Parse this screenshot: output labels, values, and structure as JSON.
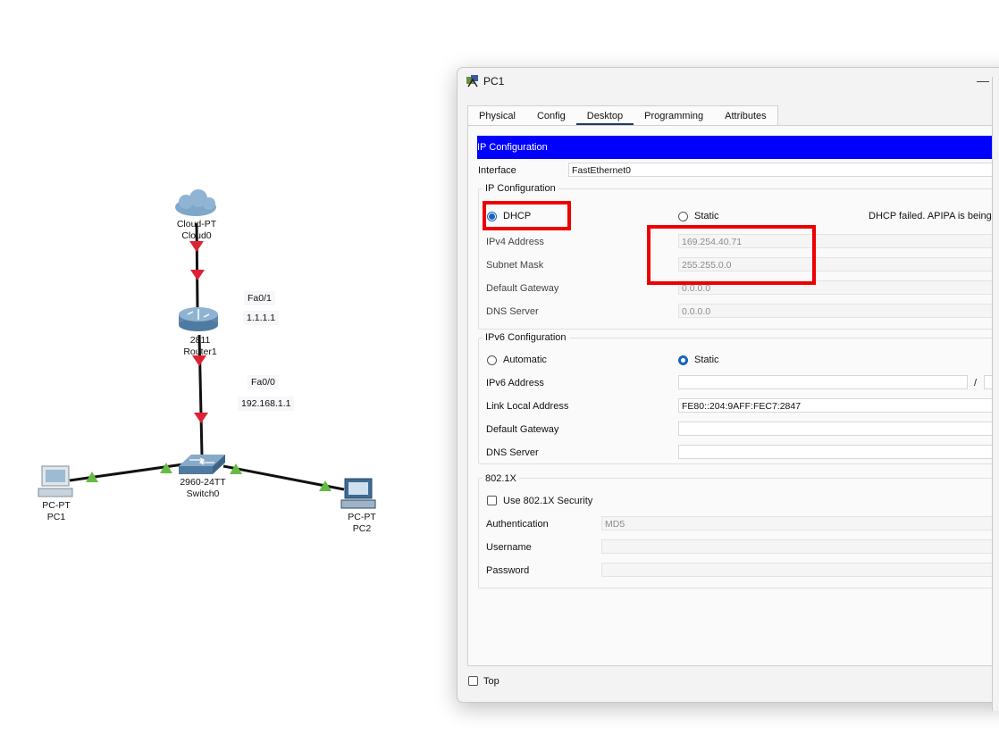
{
  "topology": {
    "devices": [
      {
        "id": "cloud",
        "type_label": "Cloud-PT",
        "name": "Cloud0"
      },
      {
        "id": "router",
        "type_label": "2811",
        "name": "Router1"
      },
      {
        "id": "switch",
        "type_label": "2960-24TT",
        "name": "Switch0"
      },
      {
        "id": "pc1",
        "type_label": "PC-PT",
        "name": "PC1"
      },
      {
        "id": "pc2",
        "type_label": "PC-PT",
        "name": "PC2"
      }
    ],
    "ports": {
      "router_top_port": "Fa0/1",
      "router_top_ip": "1.1.1.1",
      "router_bottom_port": "Fa0/0",
      "router_bottom_ip": "192.168.1.1"
    },
    "colors": {
      "link": "#111111",
      "down_triangle": "#dd2233",
      "up_triangle": "#66bb44"
    }
  },
  "window": {
    "title": "PC1",
    "minimize_glyph": "—",
    "tabs": [
      {
        "label": "Physical",
        "active": false
      },
      {
        "label": "Config",
        "active": false
      },
      {
        "label": "Desktop",
        "active": true
      },
      {
        "label": "Programming",
        "active": false
      },
      {
        "label": "Attributes",
        "active": false
      }
    ],
    "ip_config": {
      "header": "IP Configuration",
      "interface_label": "Interface",
      "interface_value": "FastEthernet0",
      "ipv4_group_title": "IP Configuration",
      "dhcp_label": "DHCP",
      "dhcp_selected": true,
      "static_label": "Static",
      "status_text": "DHCP failed. APIPA is being u",
      "ipv4_address_label": "IPv4 Address",
      "ipv4_address_value": "169.254.40.71",
      "subnet_mask_label": "Subnet Mask",
      "subnet_mask_value": "255.255.0.0",
      "default_gateway_label": "Default Gateway",
      "default_gateway_value": "0.0.0.0",
      "dns_server_label": "DNS Server",
      "dns_server_value": "0.0.0.0",
      "ipv6_group_title": "IPv6 Configuration",
      "ipv6_automatic_label": "Automatic",
      "ipv6_static_label": "Static",
      "ipv6_static_selected": true,
      "ipv6_address_label": "IPv6 Address",
      "ipv6_address_value": "",
      "ipv6_prefix_sep": "/",
      "link_local_label": "Link Local Address",
      "link_local_value": "FE80::204:9AFF:FEC7:2847",
      "ipv6_gateway_label": "Default Gateway",
      "ipv6_gateway_value": "",
      "ipv6_dns_label": "DNS Server",
      "ipv6_dns_value": "",
      "dot1x_group_title": "802.1X",
      "use_dot1x_label": "Use 802.1X Security",
      "use_dot1x_checked": false,
      "authentication_label": "Authentication",
      "authentication_value": "MD5",
      "username_label": "Username",
      "username_value": "",
      "password_label": "Password",
      "password_value": ""
    },
    "top_checkbox_label": "Top",
    "top_checked": false
  },
  "annotations": {
    "highlight_color": "#ee0000"
  },
  "accent_colors": {
    "ip_header_bar": "#0000ff",
    "active_tab_underline": "#1f3864",
    "radio_selected": "#1565c0"
  }
}
